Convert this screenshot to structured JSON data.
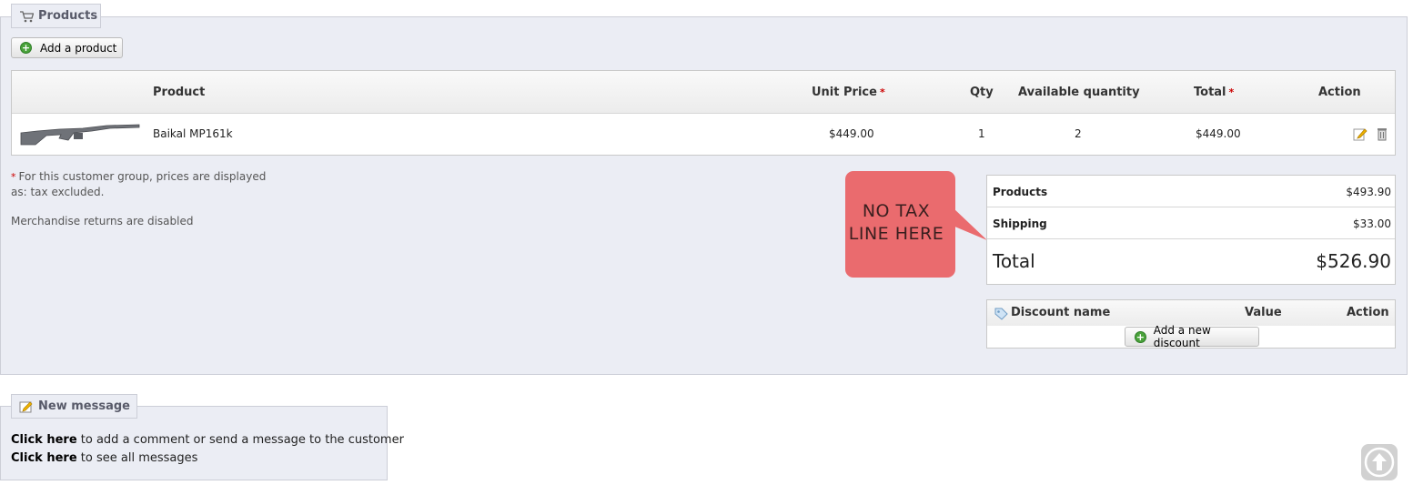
{
  "products_section": {
    "legend": "Products",
    "add_product_label": "Add a product"
  },
  "table": {
    "headers": {
      "product": "Product",
      "unit_price": "Unit Price",
      "qty": "Qty",
      "available_quantity": "Available quantity",
      "total": "Total",
      "action": "Action"
    },
    "required_mark": "*",
    "rows": [
      {
        "name": "Baikal MP161k",
        "unit_price": "$449.00",
        "qty": "1",
        "available_quantity": "2",
        "total": "$449.00"
      }
    ]
  },
  "notes": {
    "tax_note_line1": "For this customer group, prices are displayed",
    "tax_note_line2": "as: tax excluded.",
    "returns_note": "Merchandise returns are disabled"
  },
  "totals": {
    "products_label": "Products",
    "products_value": "$493.90",
    "shipping_label": "Shipping",
    "shipping_value": "$33.00",
    "total_label": "Total",
    "total_value": "$526.90"
  },
  "callout": {
    "line1": "NO TAX",
    "line2": "LINE HERE"
  },
  "discount": {
    "name_header": "Discount name",
    "value_header": "Value",
    "action_header": "Action",
    "add_label": "Add a new discount"
  },
  "message": {
    "legend": "New message",
    "line1_link": "Click here",
    "line1_text": "to add a comment or send a message to the customer",
    "line2_link": "Click here",
    "line2_text": "to see all messages"
  },
  "colors": {
    "panel_bg": "#ebedf4",
    "callout_bg": "#ea6b6e",
    "add_icon": "#4aa23b",
    "required": "#cc0000"
  }
}
